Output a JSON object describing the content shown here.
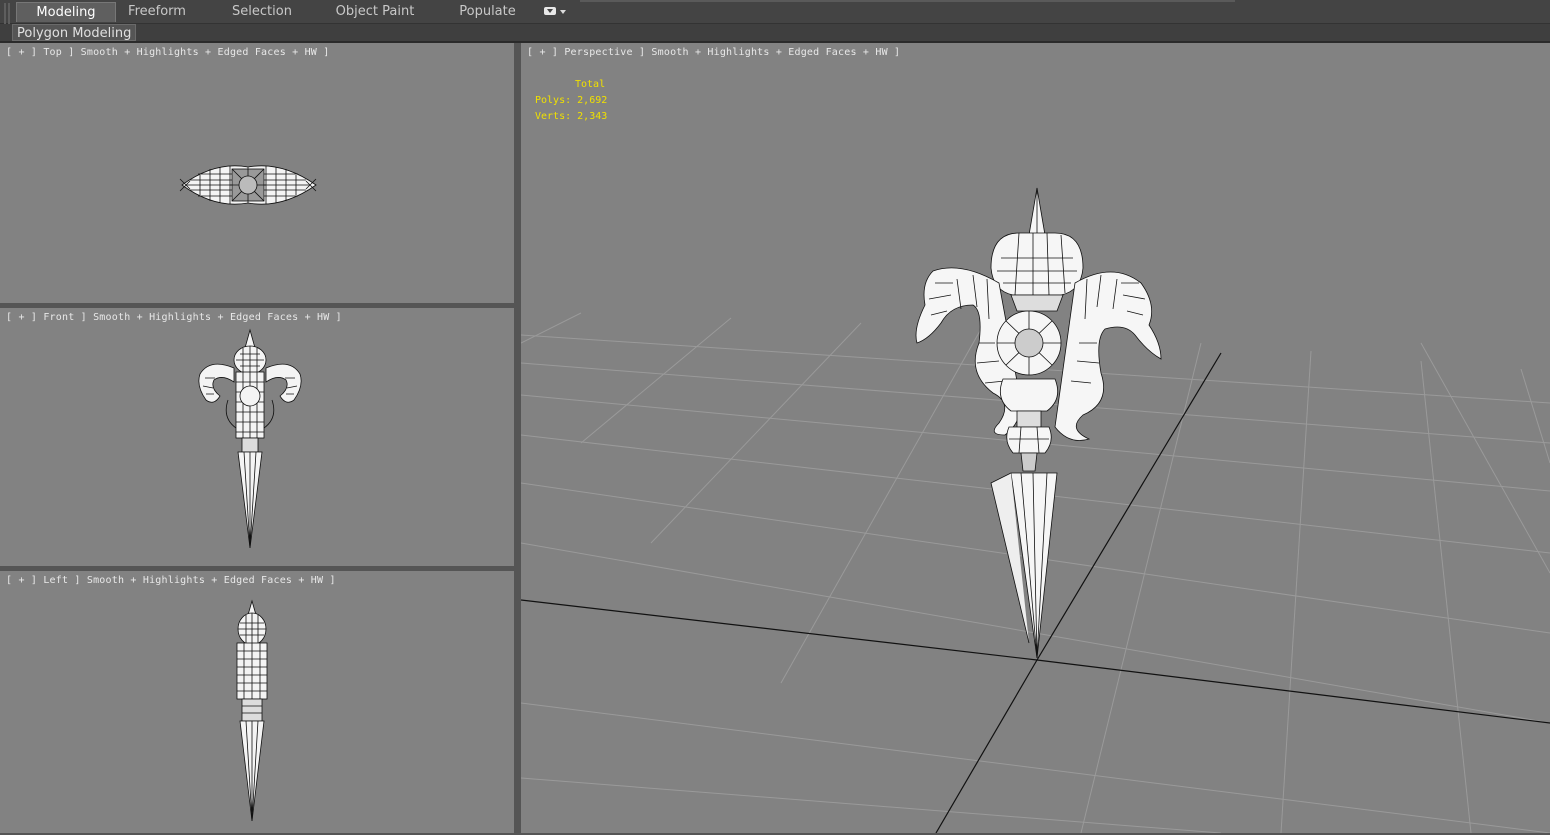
{
  "ribbon": {
    "tabs": [
      {
        "label": "Modeling",
        "active": true
      },
      {
        "label": "Freeform",
        "active": false
      },
      {
        "label": "Selection",
        "active": false
      },
      {
        "label": "Object Paint",
        "active": false
      },
      {
        "label": "Populate",
        "active": false
      }
    ],
    "panel_label": "Polygon Modeling"
  },
  "viewports": {
    "top": {
      "label": "[ + ] Top ] Smooth + Highlights + Edged Faces + HW ]"
    },
    "front": {
      "label": "[ + ] Front ] Smooth + Highlights + Edged Faces + HW ]"
    },
    "left": {
      "label": "[ + ] Left ] Smooth + Highlights + Edged Faces + HW ]"
    },
    "perspective": {
      "label": "[ + ] Perspective ] Smooth + Highlights + Edged Faces + HW ]",
      "stats": {
        "header": "Total",
        "polys_label": "Polys:",
        "polys_value": "2,692",
        "verts_label": "Verts:",
        "verts_value": "2,343"
      }
    }
  },
  "colors": {
    "viewport_bg": "#828282",
    "stats_text": "#f0e000",
    "ui_bg": "#444444"
  }
}
